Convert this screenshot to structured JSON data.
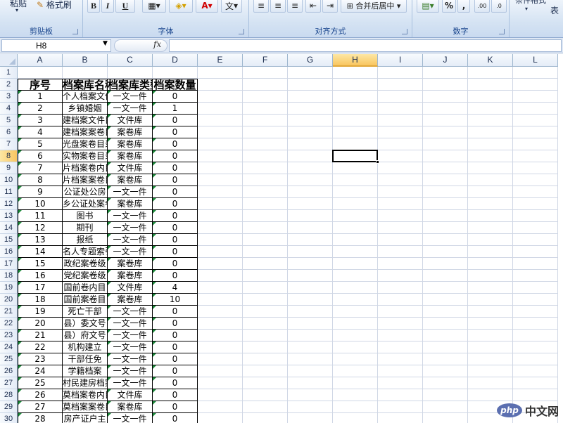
{
  "ribbon": {
    "clipboard": {
      "paste_label": "粘贴",
      "format_painter_label": "格式刷",
      "group_label": "剪贴板"
    },
    "font": {
      "bold": "B",
      "italic": "I",
      "underline": "U",
      "font_color_glyph": "A",
      "wen": "文",
      "group_label": "字体"
    },
    "alignment": {
      "merge_center_label": "合并后居中",
      "group_label": "对齐方式"
    },
    "number": {
      "percent": "%",
      "comma": ",",
      "inc_decimal": ".00",
      "dec_decimal": ".0",
      "group_label": "数字"
    },
    "styles": {
      "cond_format_label": "条件格式",
      "table_label": "表"
    }
  },
  "formula_bar": {
    "name_box": "H8",
    "fx": "fx",
    "formula": ""
  },
  "columns": [
    "A",
    "B",
    "C",
    "D",
    "E",
    "F",
    "G",
    "H",
    "I",
    "J",
    "K",
    "L"
  ],
  "selected_cell": "H8",
  "rows": [
    {
      "n": "1",
      "a": "",
      "b": "",
      "c": "",
      "d": ""
    },
    {
      "n": "2",
      "a": "序号",
      "b": "档案库名称",
      "c": "档案库类型",
      "d": "档案数量",
      "header": true
    },
    {
      "n": "3",
      "a": "1",
      "b": "个人档案文件",
      "c": "一文一件",
      "d": "0"
    },
    {
      "n": "4",
      "a": "2",
      "b": "乡镇婚姻",
      "c": "一文一件",
      "d": "1"
    },
    {
      "n": "5",
      "a": "3",
      "b": "建档案文件目",
      "c": "文件库",
      "d": "0"
    },
    {
      "n": "6",
      "a": "4",
      "b": "建档案案卷目",
      "c": "案卷库",
      "d": "0"
    },
    {
      "n": "7",
      "a": "5",
      "b": "光盘案卷目录",
      "c": "案卷库",
      "d": "0"
    },
    {
      "n": "8",
      "a": "6",
      "b": "实物案卷目录",
      "c": "案卷库",
      "d": "0"
    },
    {
      "n": "9",
      "a": "7",
      "b": "片档案卷内目",
      "c": "文件库",
      "d": "0"
    },
    {
      "n": "10",
      "a": "8",
      "b": "片档案案卷目",
      "c": "案卷库",
      "d": "0"
    },
    {
      "n": "11",
      "a": "9",
      "b": "公证处公房",
      "c": "一文一件",
      "d": "0"
    },
    {
      "n": "12",
      "a": "10",
      "b": "乡公证处案卷",
      "c": "案卷库",
      "d": "0"
    },
    {
      "n": "13",
      "a": "11",
      "b": "图书",
      "c": "一文一件",
      "d": "0"
    },
    {
      "n": "14",
      "a": "12",
      "b": "期刊",
      "c": "一文一件",
      "d": "0"
    },
    {
      "n": "15",
      "a": "13",
      "b": "报纸",
      "c": "一文一件",
      "d": "0"
    },
    {
      "n": "16",
      "a": "14",
      "b": "名人专题索引",
      "c": "一文一件",
      "d": "0"
    },
    {
      "n": "17",
      "a": "15",
      "b": "政纪案卷级",
      "c": "案卷库",
      "d": "0"
    },
    {
      "n": "18",
      "a": "16",
      "b": "党纪案卷级",
      "c": "案卷库",
      "d": "0"
    },
    {
      "n": "19",
      "a": "17",
      "b": "国前卷内目",
      "c": "文件库",
      "d": "4"
    },
    {
      "n": "20",
      "a": "18",
      "b": "国前案卷目",
      "c": "案卷库",
      "d": "10"
    },
    {
      "n": "21",
      "a": "19",
      "b": "死亡干部",
      "c": "一文一件",
      "d": "0"
    },
    {
      "n": "22",
      "a": "20",
      "b": "县）委文号",
      "c": "一文一件",
      "d": "0"
    },
    {
      "n": "23",
      "a": "21",
      "b": "县）府文号",
      "c": "一文一件",
      "d": "0"
    },
    {
      "n": "24",
      "a": "22",
      "b": "机构建立",
      "c": "一文一件",
      "d": "0"
    },
    {
      "n": "25",
      "a": "23",
      "b": "干部任免",
      "c": "一文一件",
      "d": "0"
    },
    {
      "n": "26",
      "a": "24",
      "b": "学籍档案",
      "c": "一文一件",
      "d": "0"
    },
    {
      "n": "27",
      "a": "25",
      "b": "村民建房档案",
      "c": "一文一件",
      "d": "0"
    },
    {
      "n": "28",
      "a": "26",
      "b": "莫档案卷内目",
      "c": "文件库",
      "d": "0"
    },
    {
      "n": "29",
      "a": "27",
      "b": "莫档案案卷目",
      "c": "案卷库",
      "d": "0"
    },
    {
      "n": "30",
      "a": "28",
      "b": "房产证户主",
      "c": "一文一件",
      "d": "0"
    }
  ],
  "watermark": {
    "logo": "php",
    "text": "中文网"
  }
}
